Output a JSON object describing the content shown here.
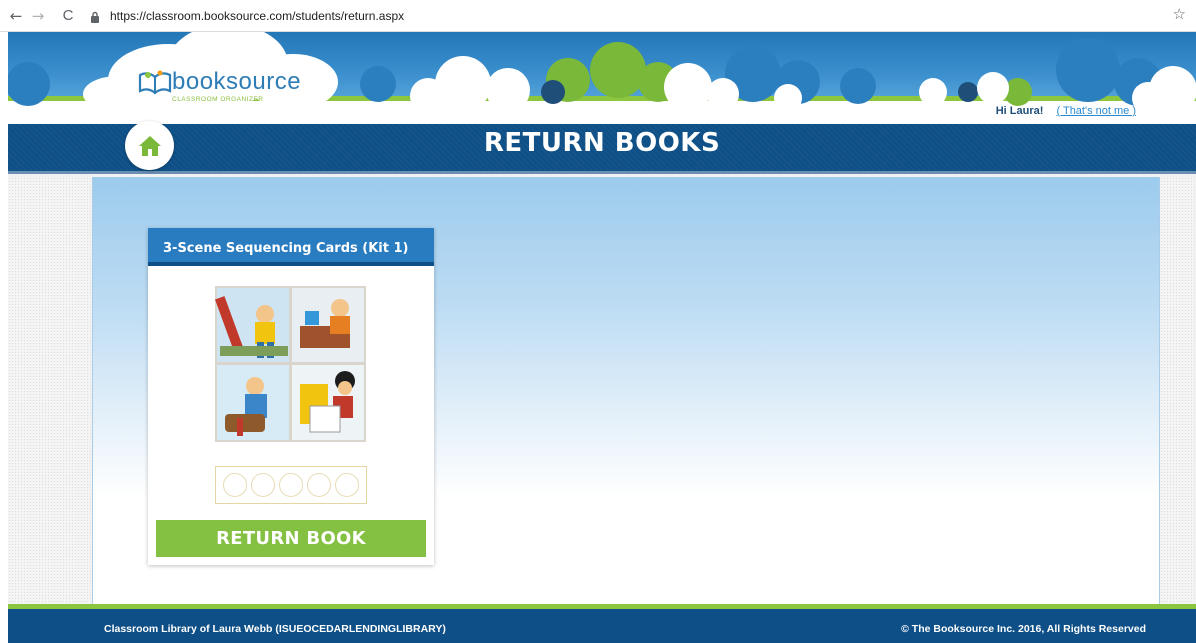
{
  "browser": {
    "url": "https://classroom.booksource.com/students/return.aspx",
    "back_icon": "←",
    "forward_icon": "→",
    "reload_icon": "C",
    "star_icon": "☆"
  },
  "header": {
    "logo_text": "booksource",
    "logo_subtitle": "CLASSROOM ORGANIZER",
    "greeting": "Hi Laura!",
    "not_me_link": "( That's not me )"
  },
  "title_bar": {
    "title": "RETURN BOOKS"
  },
  "book": {
    "title": "3-Scene Sequencing Cards (Kit 1)",
    "rating_count": 5,
    "return_button": "RETURN BOOK"
  },
  "footer": {
    "left_text": "Classroom Library of Laura Webb (ISUEOCEDARLENDINGLIBRARY)",
    "right_text": "© The Booksource Inc. 2016, All Rights Reserved"
  },
  "colors": {
    "header_blue": "#0d4f86",
    "card_header": "#2a7cc1",
    "button_green": "#84c042",
    "accent_green": "#8cc63f"
  }
}
